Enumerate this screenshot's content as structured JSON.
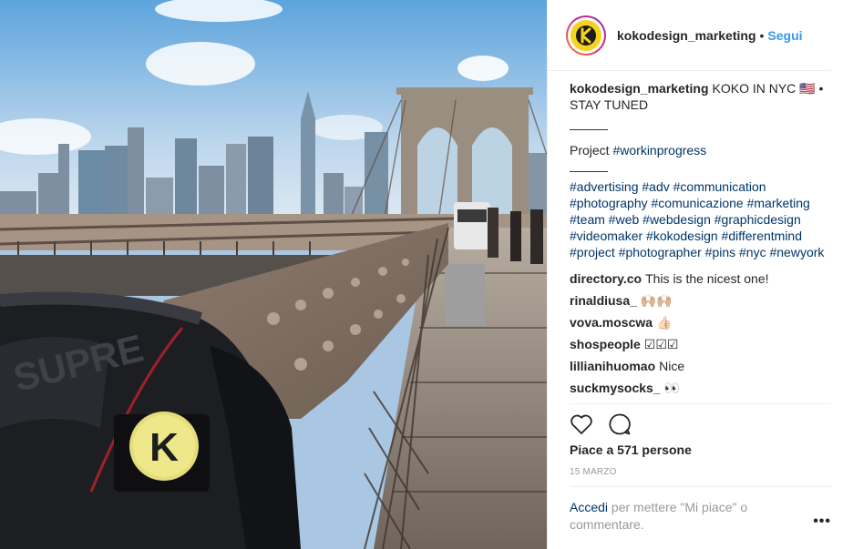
{
  "post": {
    "image_alt": "Backpack with koko badge on the Brooklyn Bridge, Manhattan skyline in background"
  },
  "header": {
    "username": "kokodesign_marketing",
    "separator": "•",
    "follow_label": "Segui"
  },
  "caption": {
    "username": "kokodesign_marketing",
    "text": "KOKO IN NYC 🇺🇸 • STAY TUNED",
    "separator1": "———",
    "project_prefix": "Project ",
    "project_tag": "#workinprogress",
    "separator2": "———",
    "hashtags": "#advertising #adv #communication #photography #comunicazione #marketing #team #web #webdesign #graphicdesign #videomaker #kokodesign #differentmind #project #photographer #pins #nyc #newyork"
  },
  "comments": [
    {
      "user": "directory.co",
      "text": "This is the nicest one!"
    },
    {
      "user": "rinaldiusa_",
      "text": "🙌🏼🙌🏼"
    },
    {
      "user": "vova.moscwa",
      "text": "👍🏻"
    },
    {
      "user": "shospeople",
      "text": "☑☑☑"
    },
    {
      "user": "lillianihuomao",
      "text": "Nice"
    },
    {
      "user": "suckmysocks_",
      "text": "👀"
    }
  ],
  "actions": {
    "like_icon": "heart-icon",
    "comment_icon": "comment-icon"
  },
  "likes": "Piace a 571 persone",
  "date": "15 MARZO",
  "login": {
    "link": "Accedi",
    "text": " per mettere \"Mi piace\" o commentare."
  },
  "more_label": "•••"
}
